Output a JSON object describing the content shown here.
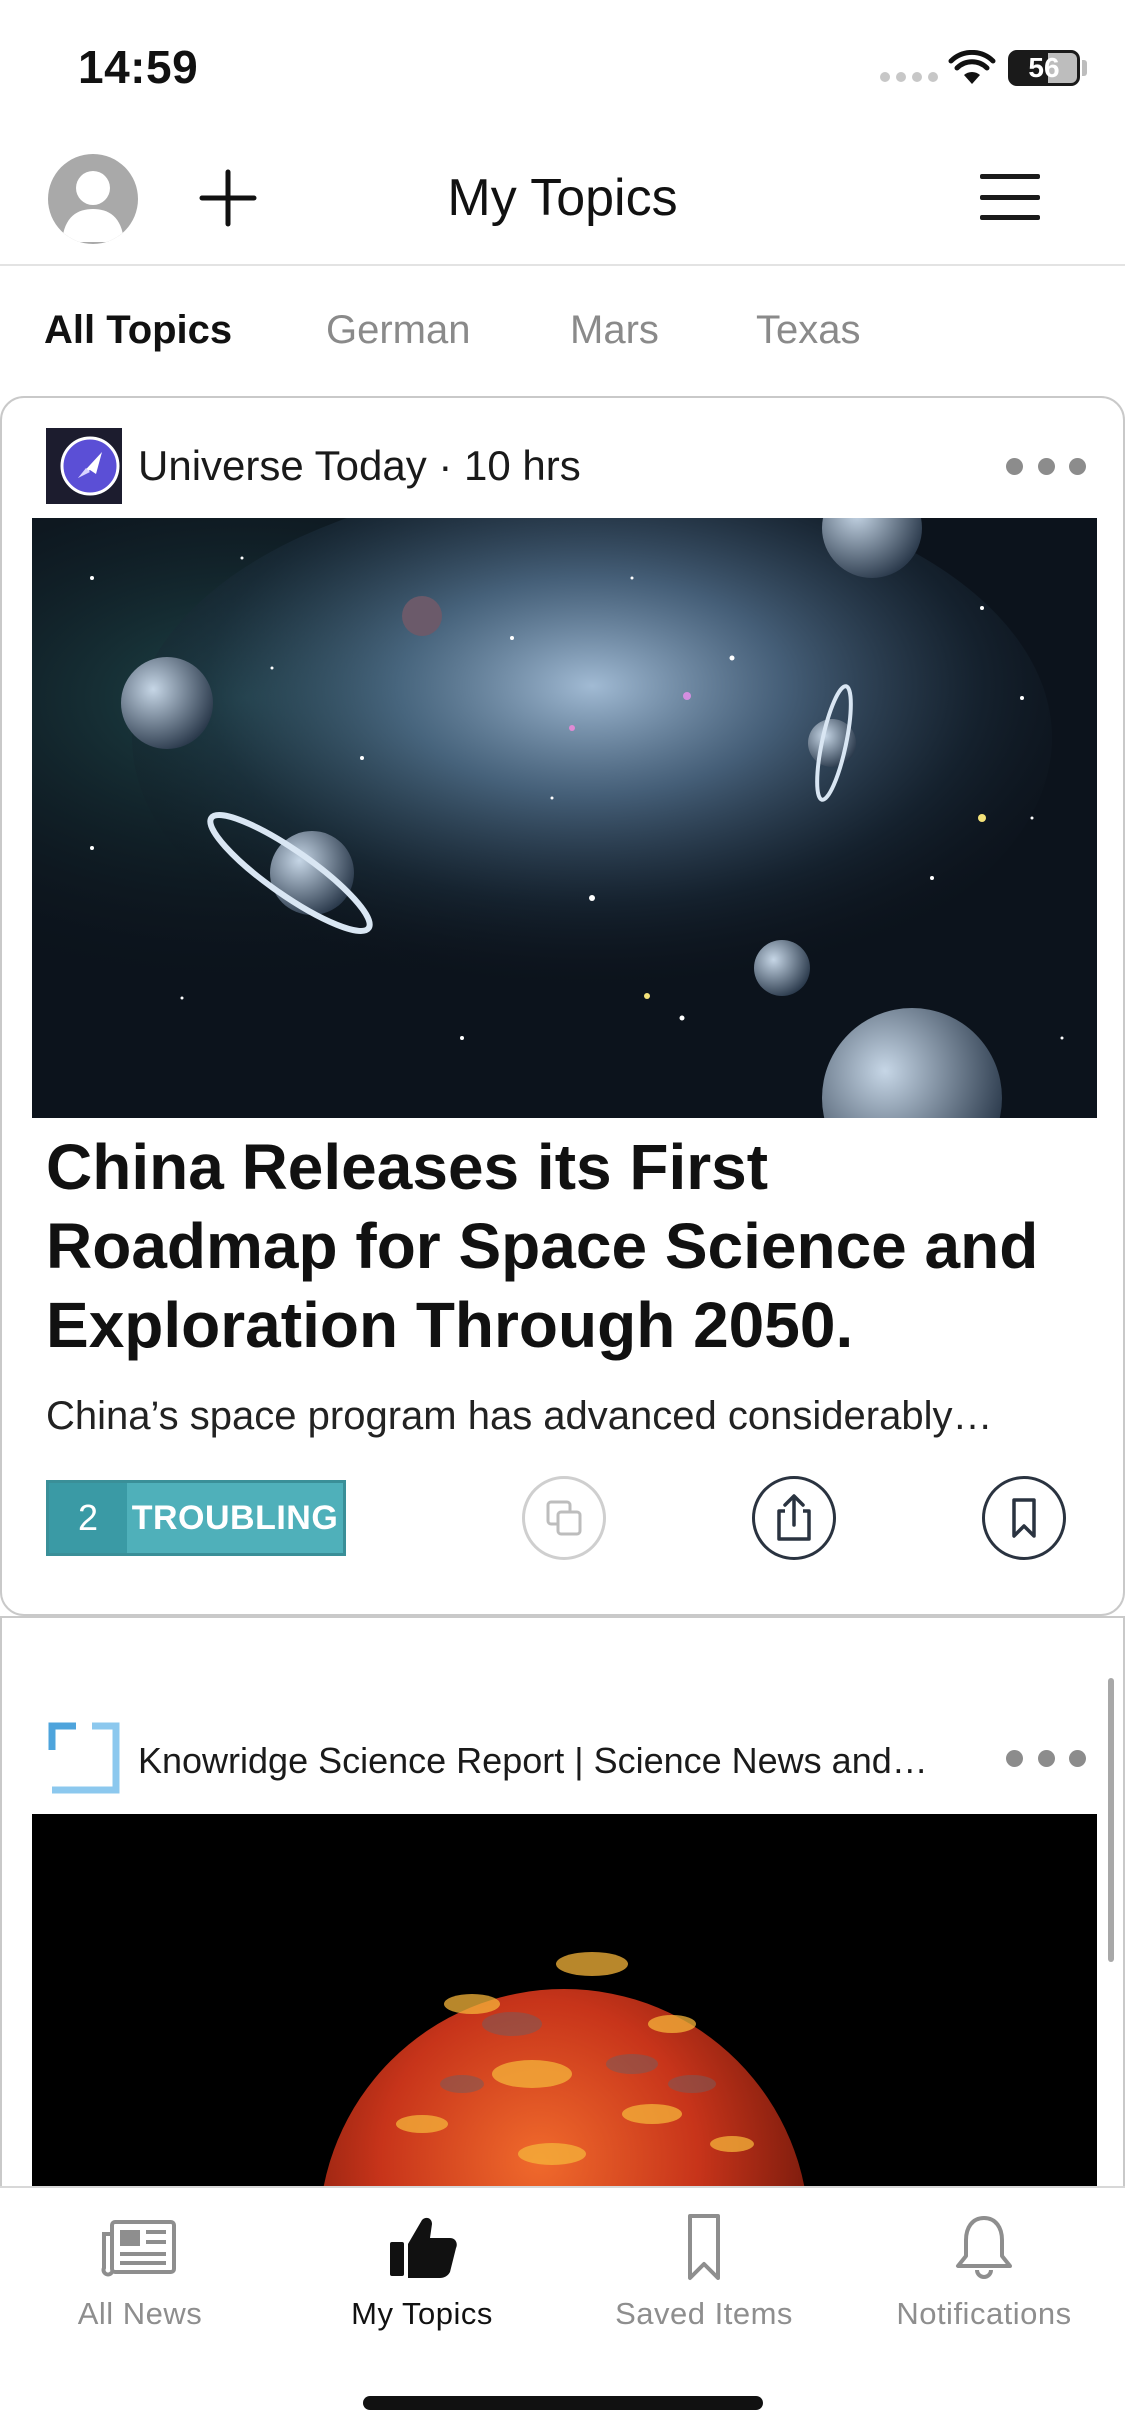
{
  "status_bar": {
    "time": "14:59",
    "battery_level": "56",
    "battery_percent": 56
  },
  "header": {
    "title": "My Topics",
    "add_icon": "plus-icon",
    "menu_icon": "hamburger-menu-icon"
  },
  "topic_tabs": [
    {
      "label": "All Topics",
      "active": true
    },
    {
      "label": "German",
      "active": false
    },
    {
      "label": "Mars",
      "active": false
    },
    {
      "label": "Texas",
      "active": false
    }
  ],
  "articles": [
    {
      "source": "Universe Today · 10 hrs",
      "source_logo_icon": "rocket-icon",
      "headline": "China Releases its First Roadmap for Space Science and Exploration Through 2050.",
      "summary": "China’s space program has advanced considerably…",
      "reaction": {
        "count": "2",
        "label": "TROUBLING"
      },
      "image_icon": "space-nebula-image"
    },
    {
      "source": "Knowridge Science Report | Science News and…",
      "source_logo_icon": "bracket-logo-icon",
      "image_icon": "lava-planet-image"
    }
  ],
  "bottom_tabs": [
    {
      "label": "All News",
      "icon": "newspaper-icon",
      "active": false
    },
    {
      "label": "My Topics",
      "icon": "thumbs-up-icon",
      "active": true
    },
    {
      "label": "Saved Items",
      "icon": "bookmark-icon",
      "active": false
    },
    {
      "label": "Notifications",
      "icon": "bell-icon",
      "active": false
    }
  ],
  "colors": {
    "reaction_dark": "#3a9aa5",
    "reaction_light": "#4fb0ba",
    "text_primary": "#111111",
    "text_muted": "#8e8e8e"
  }
}
